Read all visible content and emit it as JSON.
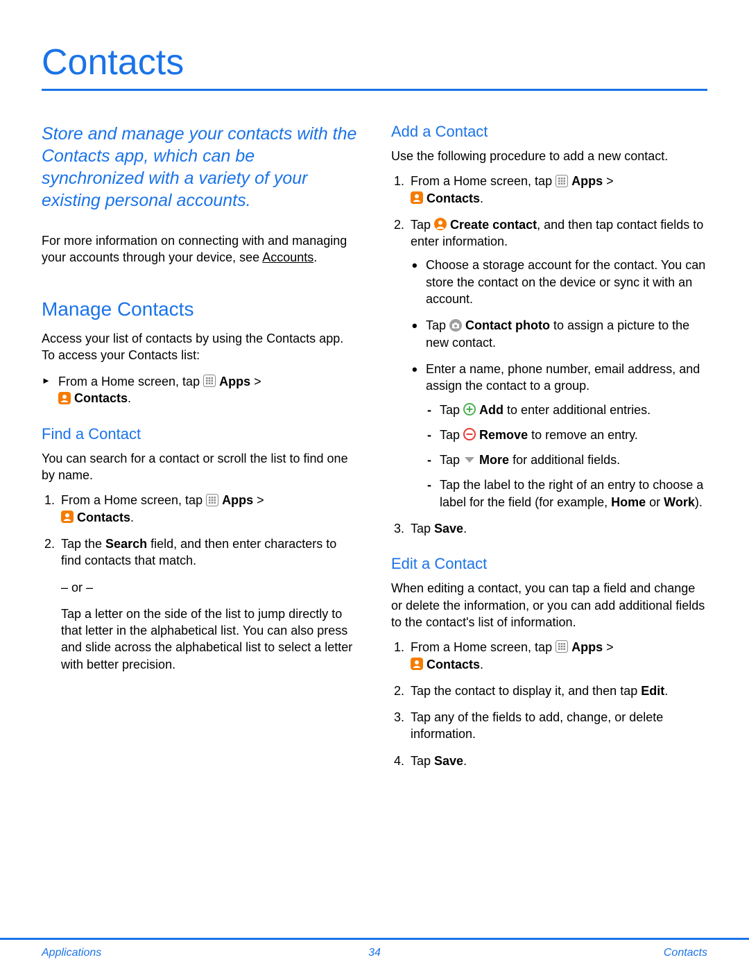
{
  "title": "Contacts",
  "intro": "Store and manage your contacts with the Contacts app, which can be synchronized with a variety of your existing personal accounts.",
  "more_info_prefix": "For more information on connecting with and managing your accounts through your device, see ",
  "accounts_link": "Accounts",
  "period": ".",
  "manage_heading": "Manage Contacts",
  "manage_text": "Access your list of contacts by using the Contacts app. To access your Contacts list:",
  "home_prefix": "From a Home screen, tap ",
  "apps_label": "Apps",
  "gt": " > ",
  "contacts_label": "Contacts",
  "find_heading": "Find a Contact",
  "find_text": "You can search for a contact or scroll the list to find one by name.",
  "find_step2a": "Tap the ",
  "search_label": "Search",
  "find_step2b": " field, and then enter characters to find contacts that match.",
  "or_text": "– or –",
  "find_alt": "Tap a letter on the side of the list to jump directly to that letter in the alphabetical list. You can also press and slide across the alphabetical list to select a letter with better precision.",
  "add_heading": "Add a Contact",
  "add_text": "Use the following procedure to add a new contact.",
  "tap_word": "Tap ",
  "create_contact_label": "Create contact",
  "create_suffix": ", and then tap contact fields to enter information.",
  "bullet_store": "Choose a storage account for the contact. You can store the contact on the device or sync it with an account.",
  "contact_photo_label": "Contact photo",
  "contact_photo_suffix": " to assign a picture to the new contact.",
  "bullet_name": "Enter a name, phone number, email address, and assign the contact to a group.",
  "add_label": "Add",
  "add_suffix": " to enter additional entries.",
  "remove_label": "Remove",
  "remove_suffix": " to remove an entry.",
  "more_label": "More",
  "more_suffix": " for additional fields.",
  "dash_label": "Tap the label to the right of an entry to choose a label for the field (for example, ",
  "home_label": "Home",
  "or_word": " or ",
  "work_label": "Work",
  "paren_close": ").",
  "tap_save_prefix": "Tap ",
  "save_label": "Save",
  "edit_heading": "Edit a Contact",
  "edit_text": "When editing a contact, you can tap a field and change or delete the information, or you can add additional fields to the contact's list of information.",
  "edit_step2a": "Tap the contact to display it, and then tap ",
  "edit_label": "Edit",
  "edit_step3": "Tap any of the fields to add, change, or delete information.",
  "footer_left": "Applications",
  "footer_page": "34",
  "footer_right": "Contacts"
}
